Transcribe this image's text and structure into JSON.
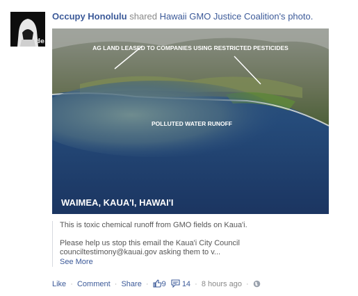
{
  "post": {
    "actor": "Occupy Honolulu",
    "verb": "shared",
    "source": "Hawaii GMO Justice Coalition's",
    "object": "photo."
  },
  "avatar": {
    "label": "de"
  },
  "photo": {
    "overlay_top": "AG LAND LEASED TO COMPANIES USING RESTRICTED PESTICIDES",
    "overlay_middle": "POLLUTED WATER RUNOFF",
    "overlay_bottom": "WAIMEA,  KAUA'I, HAWAI'I"
  },
  "caption": {
    "line1": "This is toxic chemical runoff from GMO fields on Kaua'i.",
    "line2": "Please help us stop this email the Kaua'i City Council",
    "line3": "counciltestimony@kauai.gov asking them to v...",
    "see_more": "See More"
  },
  "actions": {
    "like": "Like",
    "comment": "Comment",
    "share": "Share",
    "like_count": "9",
    "comment_count": "14",
    "time": "8 hours ago"
  },
  "colors": {
    "link": "#3b5998",
    "muted": "#888888",
    "ocean_dark": "#1f3b66",
    "ocean_runoff": "#4b6b80"
  },
  "icons": [
    "thumbs-up-icon",
    "comment-icon",
    "globe-icon"
  ]
}
